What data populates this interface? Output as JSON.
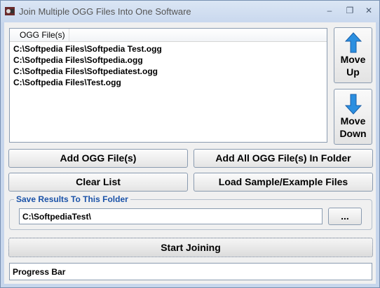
{
  "window": {
    "title": "Join Multiple OGG Files Into One Software",
    "minimize_glyph": "–",
    "restore_glyph": "❐",
    "close_glyph": "✕"
  },
  "file_list": {
    "header": "OGG File(s)",
    "items": [
      "C:\\Softpedia Files\\Softpedia Test.ogg",
      "C:\\Softpedia Files\\Softpedia.ogg",
      "C:\\Softpedia Files\\Softpediatest.ogg",
      "C:\\Softpedia Files\\Test.ogg"
    ]
  },
  "side_buttons": {
    "move_up": [
      "Move",
      "Up"
    ],
    "move_down": [
      "Move",
      "Down"
    ],
    "up_icon": "arrow-up-icon",
    "down_icon": "arrow-down-icon"
  },
  "buttons": {
    "add_files": "Add OGG File(s)",
    "add_folder": "Add All OGG File(s) In Folder",
    "clear_list": "Clear List",
    "load_sample": "Load Sample/Example Files",
    "browse": "...",
    "start": "Start Joining"
  },
  "output": {
    "group_label": "Save Results To This Folder",
    "folder_value": "C:\\SoftpediaTest\\"
  },
  "progress": {
    "label": "Progress Bar"
  },
  "colors": {
    "accent": "#1a52a8",
    "arrow": "#2b8fe0"
  }
}
